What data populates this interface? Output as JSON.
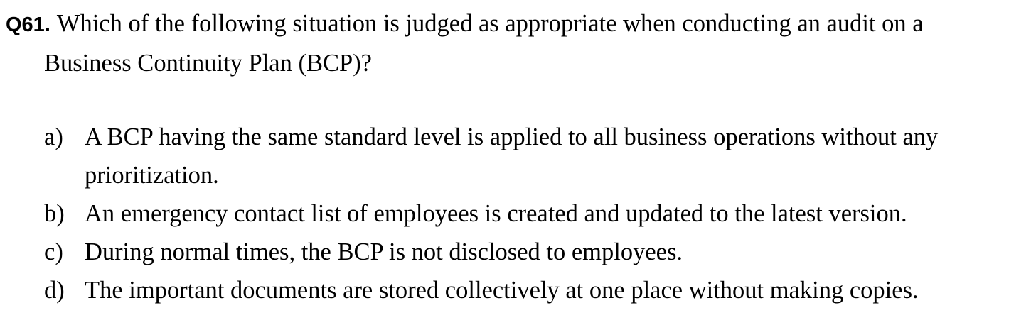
{
  "question": {
    "number": "Q61.",
    "text_line1": "Which of the following situation is judged as appropriate when conducting an audit on a",
    "text_line2": "Business Continuity Plan (BCP)?"
  },
  "options": [
    {
      "letter": "a)",
      "line1": "A BCP having the same standard level is applied to all business operations without any",
      "line2": "prioritization."
    },
    {
      "letter": "b)",
      "line1": "An emergency contact list of employees is created and updated to the latest version."
    },
    {
      "letter": "c)",
      "line1": "During normal times, the BCP is not disclosed to employees."
    },
    {
      "letter": "d)",
      "line1": "The important documents are stored collectively at one place without making copies."
    }
  ]
}
